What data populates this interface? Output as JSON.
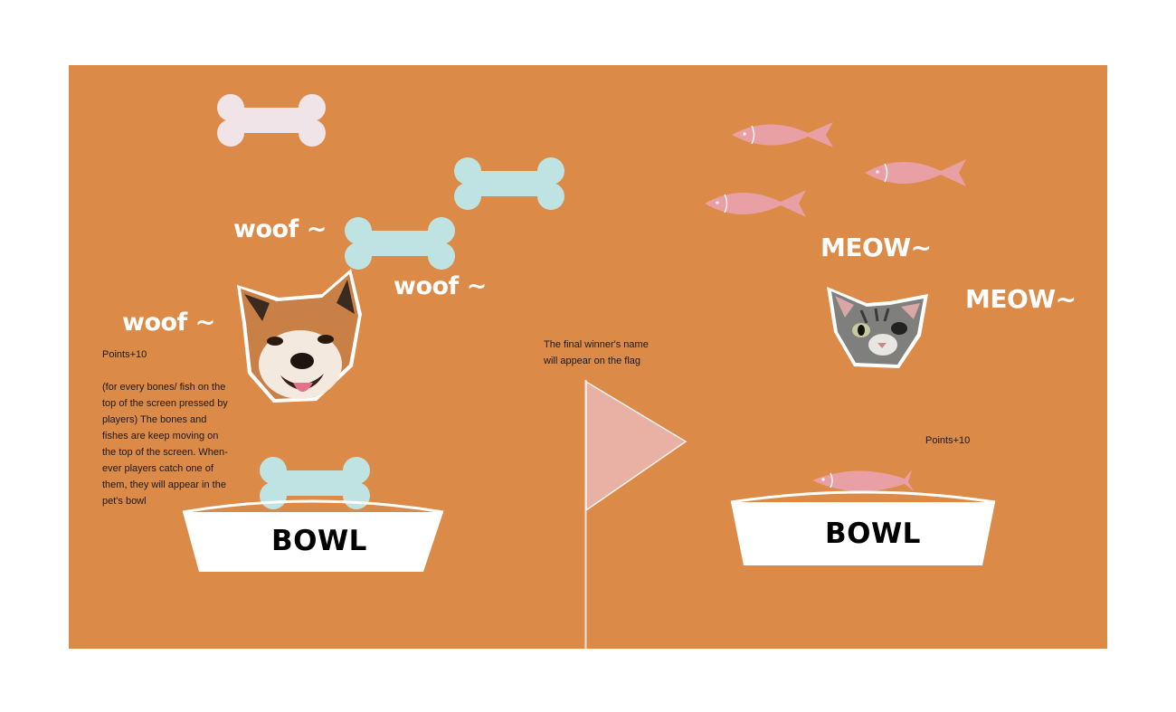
{
  "colors": {
    "board": "#DC8A47",
    "bone_pale": "#F1E4E8",
    "bone_blue": "#BFE3E2",
    "fish": "#E8A0A4",
    "flag": "#E9B1A4",
    "bowl": "#FFFFFF"
  },
  "dog_side": {
    "barks": [
      "woof ~",
      "woof ~",
      "woof ~"
    ],
    "avatar_icon": "shiba-dog-face-icon",
    "points_label": "Points+10",
    "instructions": [
      "(for every bones/ fish on the",
      "top of the screen pressed by",
      "players) The bones and",
      "fishes are keep moving on",
      "the top of the screen. When-",
      "ever players catch one of",
      "them, they will appear in the",
      "pet's bowl"
    ],
    "bowl_label": "BOWL"
  },
  "cat_side": {
    "meows": [
      "MEOW~",
      "MEOW~"
    ],
    "avatar_icon": "tabby-cat-face-icon",
    "points_label": "Points+10",
    "bowl_label": "BOWL"
  },
  "finish": {
    "flag_note_lines": [
      "The final winner's name",
      "will appear on the flag"
    ]
  }
}
